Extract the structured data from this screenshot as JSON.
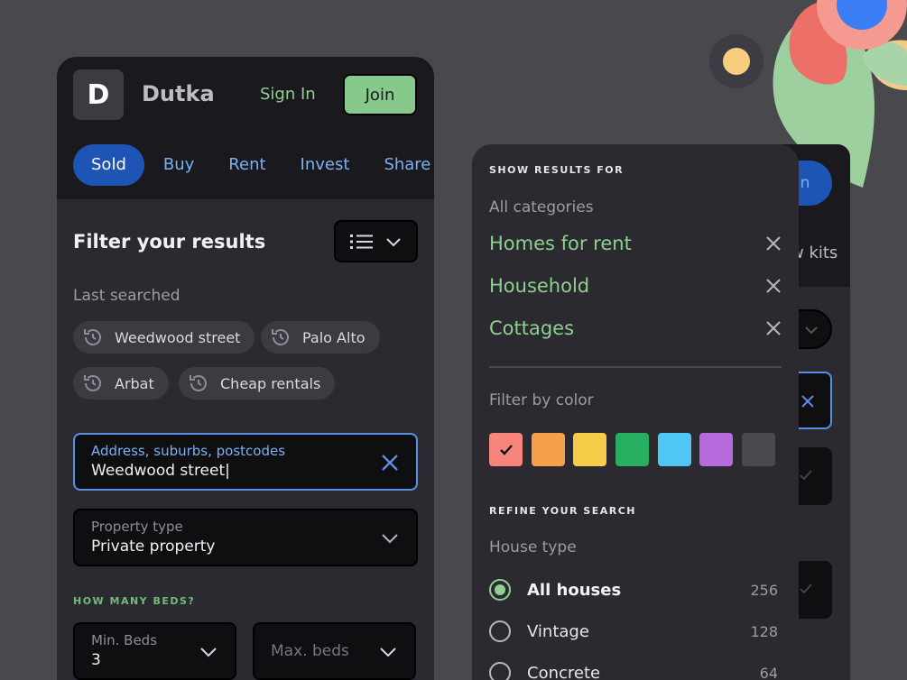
{
  "app": {
    "logo_letter": "D",
    "name": "Dutka",
    "sign_in_label": "Sign In",
    "join_label": "Join"
  },
  "tabs": [
    "Sold",
    "Buy",
    "Rent",
    "Invest",
    "Share"
  ],
  "filter": {
    "title": "Filter your results",
    "last_searched_label": "Last searched",
    "chips": [
      "Weedwood street",
      "Palo Alto",
      "Arbat",
      "Cheap rentals"
    ],
    "address": {
      "label": "Address, suburbs, postcodes",
      "value": "Weedwood street|"
    },
    "property_type": {
      "label": "Property type",
      "value": "Private property"
    },
    "beds_label": "HOW MANY BEDS?",
    "min_beds": {
      "label": "Min. Beds",
      "value": "3"
    },
    "max_beds": {
      "placeholder": "Max. beds"
    }
  },
  "panel": {
    "show_results_label": "SHOW RESULTS FOR",
    "all_categories_label": "All categories",
    "categories": [
      "Homes for rent",
      "Household",
      "Cottages"
    ],
    "filter_by_color_label": "Filter by color",
    "colors": [
      {
        "name": "red",
        "hex": "#f8857b",
        "selected": true
      },
      {
        "name": "orange",
        "hex": "#f6a04c",
        "selected": false
      },
      {
        "name": "yellow",
        "hex": "#f6cc48",
        "selected": false
      },
      {
        "name": "green",
        "hex": "#27ae60",
        "selected": false
      },
      {
        "name": "light-blue",
        "hex": "#4fc7f2",
        "selected": false
      },
      {
        "name": "purple",
        "hex": "#b56bdc",
        "selected": false
      },
      {
        "name": "gray",
        "hex": "#4a4950",
        "selected": false
      }
    ],
    "refine_label": "REFINE YOUR SEARCH",
    "house_type_label": "House type",
    "house_types": [
      {
        "label": "All houses",
        "count": "256",
        "selected": true
      },
      {
        "label": "Vintage",
        "count": "128",
        "selected": false
      },
      {
        "label": "Concrete",
        "count": "64",
        "selected": false
      }
    ]
  },
  "back_phone": {
    "partial_button": "n",
    "partial_tab": "w kits"
  },
  "colors": {
    "accent_green": "#8fd08f",
    "accent_blue": "#1e54b4",
    "link_blue": "#7cb1f0"
  }
}
